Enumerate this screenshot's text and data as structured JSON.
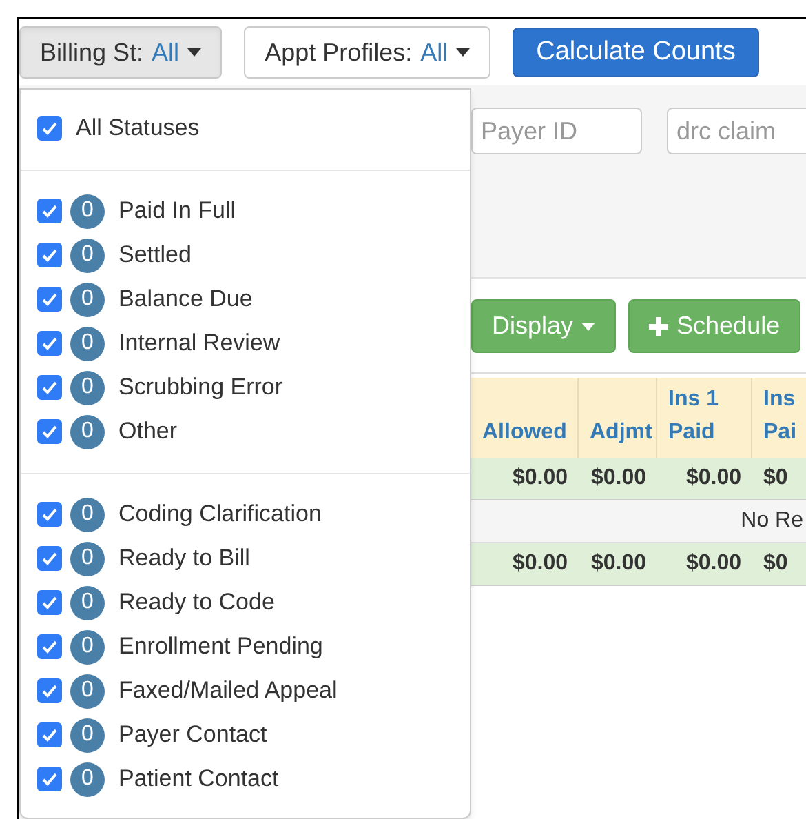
{
  "toolbar": {
    "billing_filter": {
      "label": "Billing St:",
      "value": "All",
      "expanded": true
    },
    "appt_filter": {
      "label": "Appt Profiles:",
      "value": "All",
      "expanded": false
    },
    "calculate_button": "Calculate Counts"
  },
  "search_fields": [
    {
      "placeholder": "Payer ID"
    },
    {
      "placeholder": "drc claim"
    }
  ],
  "actions": [
    {
      "label": "Display",
      "kind": "dropdown"
    },
    {
      "label": "Schedule",
      "kind": "add"
    }
  ],
  "table": {
    "columns": [
      "Allowed",
      "Adjmt",
      "Ins 1 Paid",
      "Ins Pai"
    ],
    "rows": [
      {
        "kind": "total",
        "cells": [
          "$0.00",
          "$0.00",
          "$0.00",
          "$0"
        ]
      },
      {
        "kind": "message",
        "text": "No Re"
      },
      {
        "kind": "total",
        "cells": [
          "$0.00",
          "$0.00",
          "$0.00",
          "$0"
        ]
      }
    ]
  },
  "status_menu": {
    "all": {
      "label": "All Statuses",
      "checked": true
    },
    "groups": [
      [
        {
          "label": "Paid In Full",
          "count": "0",
          "checked": true
        },
        {
          "label": "Settled",
          "count": "0",
          "checked": true
        },
        {
          "label": "Balance Due",
          "count": "0",
          "checked": true
        },
        {
          "label": "Internal Review",
          "count": "0",
          "checked": true
        },
        {
          "label": "Scrubbing Error",
          "count": "0",
          "checked": true
        },
        {
          "label": "Other",
          "count": "0",
          "checked": true
        }
      ],
      [
        {
          "label": "Coding Clarification",
          "count": "0",
          "checked": true
        },
        {
          "label": "Ready to Bill",
          "count": "0",
          "checked": true
        },
        {
          "label": "Ready to Code",
          "count": "0",
          "checked": true
        },
        {
          "label": "Enrollment Pending",
          "count": "0",
          "checked": true
        },
        {
          "label": "Faxed/Mailed Appeal",
          "count": "0",
          "checked": true
        },
        {
          "label": "Payer Contact",
          "count": "0",
          "checked": true
        },
        {
          "label": "Patient Contact",
          "count": "0",
          "checked": true
        }
      ]
    ]
  }
}
